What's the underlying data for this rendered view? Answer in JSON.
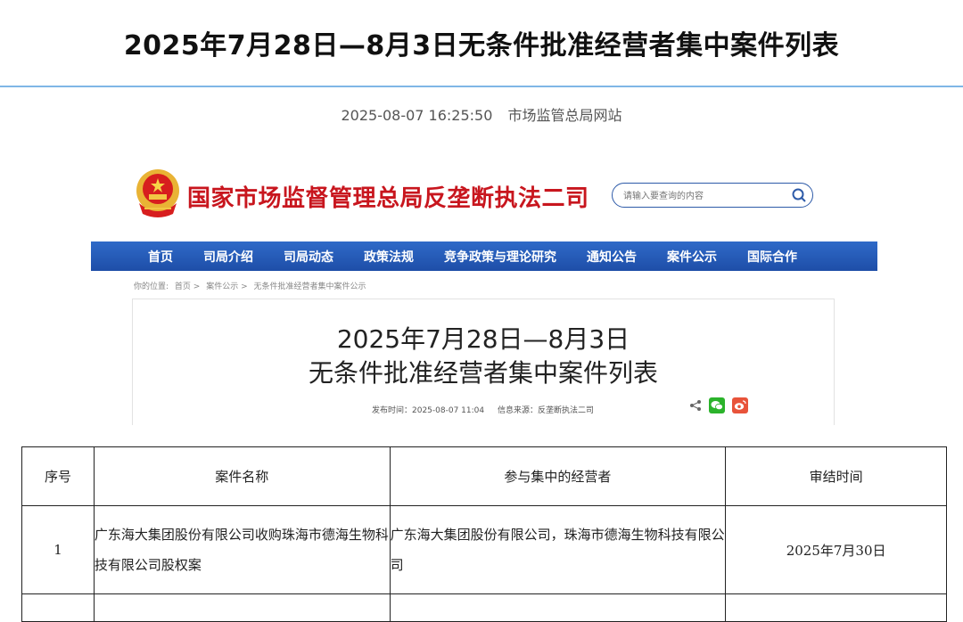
{
  "page": {
    "title": "2025年7月28日—8月3日无条件批准经营者集中案件列表",
    "publish_datetime": "2025-08-07 16:25:50",
    "source": "市场监管总局网站"
  },
  "site": {
    "name": "国家市场监督管理总局反垄断执法二司",
    "search_placeholder": "请输入要查询的内容",
    "emblem_icon": "national-emblem-icon",
    "brand_color": "#c8161e",
    "nav_color": "#2a5fba",
    "nav": [
      "首页",
      "司局介绍",
      "司局动态",
      "政策法规",
      "竞争政策与理论研究",
      "通知公告",
      "案件公示",
      "国际合作"
    ]
  },
  "breadcrumb": [
    "你的位置:",
    "首页 >",
    "案件公示 >",
    "无条件批准经营者集中案件公示"
  ],
  "article": {
    "title_line1": "2025年7月28日—8月3日",
    "title_line2": "无条件批准经营者集中案件列表",
    "publish_time": "发布时间：2025-08-07 11:04",
    "info_source": "信息来源：反垄断执法二司",
    "share_icons": [
      "share-icon",
      "wechat-icon",
      "weibo-icon"
    ]
  },
  "table": {
    "headers": [
      "序号",
      "案件名称",
      "参与集中的经营者",
      "审结时间"
    ],
    "rows": [
      {
        "index": "1",
        "case_name": "广东海大集团股份有限公司收购珠海市德海生物科技有限公司股权案",
        "parties": "广东海大集团股份有限公司，珠海市德海生物科技有限公司",
        "date": "2025年7月30日"
      }
    ]
  }
}
